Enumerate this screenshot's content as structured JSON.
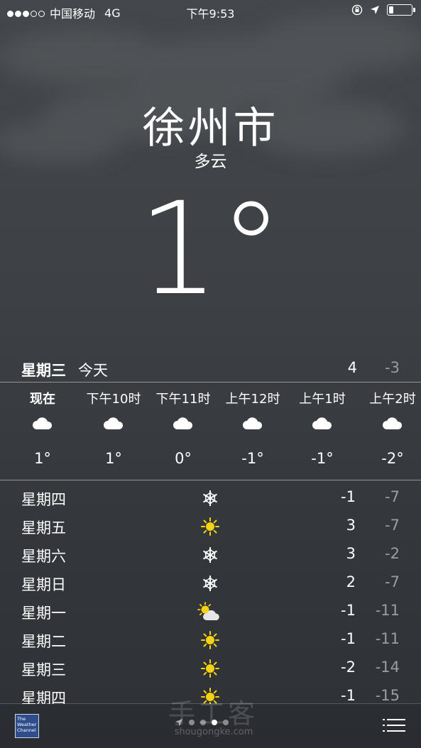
{
  "status_bar": {
    "carrier": "中国移动",
    "network": "4G",
    "time": "下午9:53",
    "signal_bars_filled": 3,
    "signal_bars_total": 5,
    "battery_level": 0.2
  },
  "location": {
    "city": "徐州市",
    "condition": "多云",
    "temperature": "1°"
  },
  "today": {
    "day": "星期三",
    "label": "今天",
    "high": "4",
    "low": "-3"
  },
  "hourly": [
    {
      "time": "现在",
      "icon": "cloud-icon",
      "temp": "1°"
    },
    {
      "time": "下午10时",
      "icon": "cloud-icon",
      "temp": "1°"
    },
    {
      "time": "下午11时",
      "icon": "cloud-icon",
      "temp": "0°"
    },
    {
      "time": "上午12时",
      "icon": "cloud-icon",
      "temp": "-1°"
    },
    {
      "time": "上午1时",
      "icon": "cloud-icon",
      "temp": "-1°"
    },
    {
      "time": "上午2时",
      "icon": "cloud-icon",
      "temp": "-2°"
    }
  ],
  "daily": [
    {
      "day": "星期四",
      "icon": "snow-icon",
      "high": "-1",
      "low": "-7"
    },
    {
      "day": "星期五",
      "icon": "sun-icon",
      "high": "3",
      "low": "-7"
    },
    {
      "day": "星期六",
      "icon": "snow-icon",
      "high": "3",
      "low": "-2"
    },
    {
      "day": "星期日",
      "icon": "snow-icon",
      "high": "2",
      "low": "-7"
    },
    {
      "day": "星期一",
      "icon": "partly-cloudy-icon",
      "high": "-1",
      "low": "-11"
    },
    {
      "day": "星期二",
      "icon": "sun-icon",
      "high": "-1",
      "low": "-11"
    },
    {
      "day": "星期三",
      "icon": "sun-icon",
      "high": "-2",
      "low": "-14"
    },
    {
      "day": "星期四",
      "icon": "sun-icon",
      "high": "-1",
      "low": "-15"
    }
  ],
  "footer": {
    "logo_line1": "The",
    "logo_line2": "Weather",
    "logo_line3": "Channel",
    "page_count": 5,
    "current_page": 4
  },
  "watermark": {
    "text": "手工客",
    "url": "shougongke.com"
  },
  "colors": {
    "sun": "#f5d312",
    "secondary_text": "#9a9da1"
  }
}
